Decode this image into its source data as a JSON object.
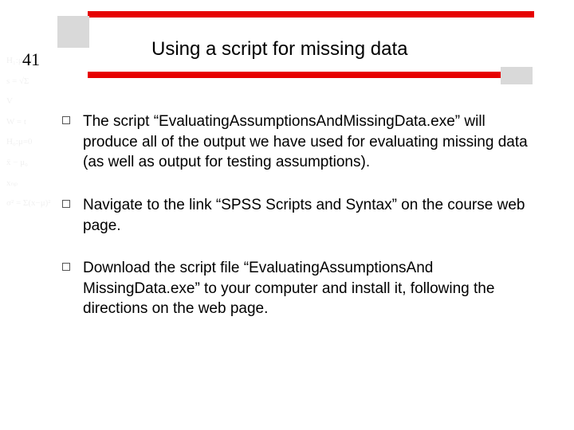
{
  "slide_number": "41",
  "title": "Using a script for missing data",
  "bullets": [
    "The script “EvaluatingAssumptionsAndMissingData.exe” will produce all of the output we have used for evaluating missing data (as well as output for testing assumptions).",
    "Navigate to the link “SPSS Scripts and Syntax” on the course web page.",
    "Download the script file “EvaluatingAssumptionsAnd MissingData.exe” to your computer and install it, following the directions on the web page."
  ],
  "colors": {
    "accent": "#e60000",
    "gray": "#d9d9d9"
  }
}
